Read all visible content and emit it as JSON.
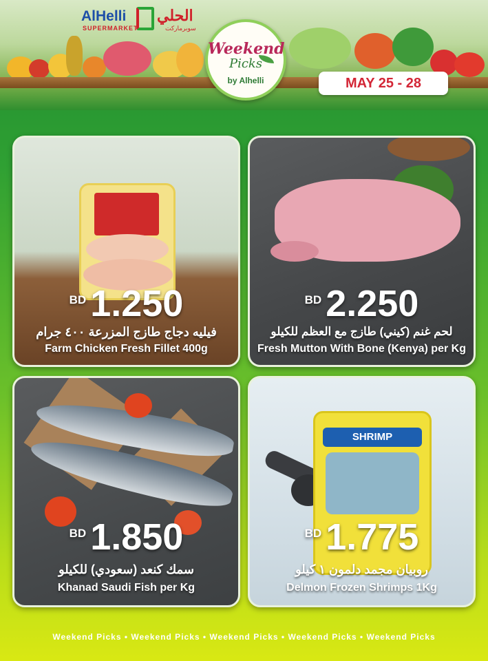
{
  "header": {
    "logo_en": "AlHelli",
    "logo_sub": "SUPERMARKET",
    "logo_ar": "الحلي",
    "logo_ar_sub": "سوبرماركت",
    "badge_line1": "Weekend",
    "badge_line2": "Picks",
    "badge_line3": "by Alhelli",
    "date_range": "MAY 25 - 28"
  },
  "products": [
    {
      "currency": "BD",
      "price": "1.250",
      "name_ar": "فيليه دجاج طازج المزرعة ٤٠٠ جرام",
      "name_en": "Farm Chicken Fresh Fillet 400g"
    },
    {
      "currency": "BD",
      "price": "2.250",
      "name_ar": "لحم غنم (كيني) طازج مع العظم للكيلو",
      "name_en": "Fresh Mutton With Bone (Kenya) per Kg"
    },
    {
      "currency": "BD",
      "price": "1.850",
      "name_ar": "سمك كنعد (سعودي) للكيلو",
      "name_en": "Khanad Saudi Fish per Kg"
    },
    {
      "currency": "BD",
      "price": "1.775",
      "name_ar": "روبيان مجمد دلمون ١ كيلو",
      "name_en": "Delmon Frozen Shrimps 1Kg"
    }
  ],
  "package_labels": {
    "shrimp_pack": "SHRIMP"
  },
  "footer_text": "Weekend Picks • Weekend Picks • Weekend Picks • Weekend Picks • Weekend Picks"
}
